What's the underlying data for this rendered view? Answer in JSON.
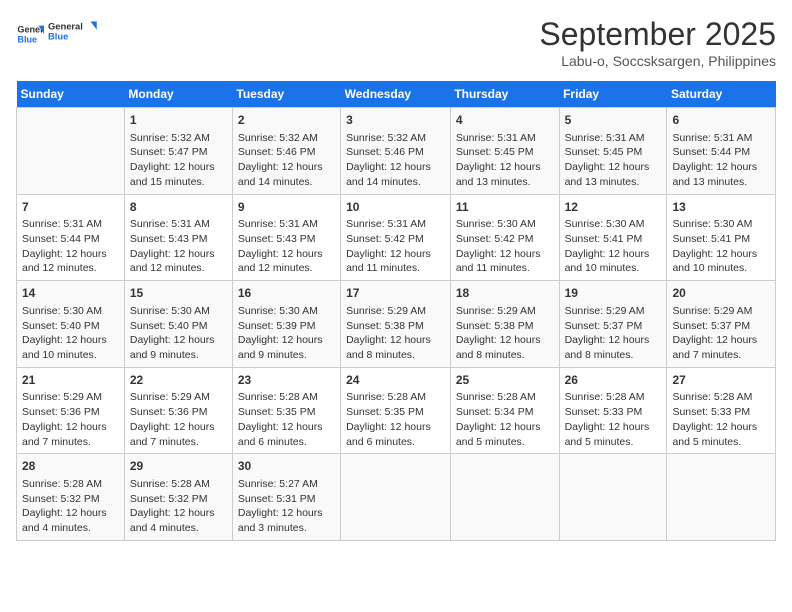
{
  "logo": {
    "line1": "General",
    "line2": "Blue"
  },
  "title": "September 2025",
  "subtitle": "Labu-o, Soccsksargen, Philippines",
  "days_of_week": [
    "Sunday",
    "Monday",
    "Tuesday",
    "Wednesday",
    "Thursday",
    "Friday",
    "Saturday"
  ],
  "weeks": [
    [
      {
        "day": "",
        "content": ""
      },
      {
        "day": "1",
        "content": "Sunrise: 5:32 AM\nSunset: 5:47 PM\nDaylight: 12 hours\nand 15 minutes."
      },
      {
        "day": "2",
        "content": "Sunrise: 5:32 AM\nSunset: 5:46 PM\nDaylight: 12 hours\nand 14 minutes."
      },
      {
        "day": "3",
        "content": "Sunrise: 5:32 AM\nSunset: 5:46 PM\nDaylight: 12 hours\nand 14 minutes."
      },
      {
        "day": "4",
        "content": "Sunrise: 5:31 AM\nSunset: 5:45 PM\nDaylight: 12 hours\nand 13 minutes."
      },
      {
        "day": "5",
        "content": "Sunrise: 5:31 AM\nSunset: 5:45 PM\nDaylight: 12 hours\nand 13 minutes."
      },
      {
        "day": "6",
        "content": "Sunrise: 5:31 AM\nSunset: 5:44 PM\nDaylight: 12 hours\nand 13 minutes."
      }
    ],
    [
      {
        "day": "7",
        "content": "Sunrise: 5:31 AM\nSunset: 5:44 PM\nDaylight: 12 hours\nand 12 minutes."
      },
      {
        "day": "8",
        "content": "Sunrise: 5:31 AM\nSunset: 5:43 PM\nDaylight: 12 hours\nand 12 minutes."
      },
      {
        "day": "9",
        "content": "Sunrise: 5:31 AM\nSunset: 5:43 PM\nDaylight: 12 hours\nand 12 minutes."
      },
      {
        "day": "10",
        "content": "Sunrise: 5:31 AM\nSunset: 5:42 PM\nDaylight: 12 hours\nand 11 minutes."
      },
      {
        "day": "11",
        "content": "Sunrise: 5:30 AM\nSunset: 5:42 PM\nDaylight: 12 hours\nand 11 minutes."
      },
      {
        "day": "12",
        "content": "Sunrise: 5:30 AM\nSunset: 5:41 PM\nDaylight: 12 hours\nand 10 minutes."
      },
      {
        "day": "13",
        "content": "Sunrise: 5:30 AM\nSunset: 5:41 PM\nDaylight: 12 hours\nand 10 minutes."
      }
    ],
    [
      {
        "day": "14",
        "content": "Sunrise: 5:30 AM\nSunset: 5:40 PM\nDaylight: 12 hours\nand 10 minutes."
      },
      {
        "day": "15",
        "content": "Sunrise: 5:30 AM\nSunset: 5:40 PM\nDaylight: 12 hours\nand 9 minutes."
      },
      {
        "day": "16",
        "content": "Sunrise: 5:30 AM\nSunset: 5:39 PM\nDaylight: 12 hours\nand 9 minutes."
      },
      {
        "day": "17",
        "content": "Sunrise: 5:29 AM\nSunset: 5:38 PM\nDaylight: 12 hours\nand 8 minutes."
      },
      {
        "day": "18",
        "content": "Sunrise: 5:29 AM\nSunset: 5:38 PM\nDaylight: 12 hours\nand 8 minutes."
      },
      {
        "day": "19",
        "content": "Sunrise: 5:29 AM\nSunset: 5:37 PM\nDaylight: 12 hours\nand 8 minutes."
      },
      {
        "day": "20",
        "content": "Sunrise: 5:29 AM\nSunset: 5:37 PM\nDaylight: 12 hours\nand 7 minutes."
      }
    ],
    [
      {
        "day": "21",
        "content": "Sunrise: 5:29 AM\nSunset: 5:36 PM\nDaylight: 12 hours\nand 7 minutes."
      },
      {
        "day": "22",
        "content": "Sunrise: 5:29 AM\nSunset: 5:36 PM\nDaylight: 12 hours\nand 7 minutes."
      },
      {
        "day": "23",
        "content": "Sunrise: 5:28 AM\nSunset: 5:35 PM\nDaylight: 12 hours\nand 6 minutes."
      },
      {
        "day": "24",
        "content": "Sunrise: 5:28 AM\nSunset: 5:35 PM\nDaylight: 12 hours\nand 6 minutes."
      },
      {
        "day": "25",
        "content": "Sunrise: 5:28 AM\nSunset: 5:34 PM\nDaylight: 12 hours\nand 5 minutes."
      },
      {
        "day": "26",
        "content": "Sunrise: 5:28 AM\nSunset: 5:33 PM\nDaylight: 12 hours\nand 5 minutes."
      },
      {
        "day": "27",
        "content": "Sunrise: 5:28 AM\nSunset: 5:33 PM\nDaylight: 12 hours\nand 5 minutes."
      }
    ],
    [
      {
        "day": "28",
        "content": "Sunrise: 5:28 AM\nSunset: 5:32 PM\nDaylight: 12 hours\nand 4 minutes."
      },
      {
        "day": "29",
        "content": "Sunrise: 5:28 AM\nSunset: 5:32 PM\nDaylight: 12 hours\nand 4 minutes."
      },
      {
        "day": "30",
        "content": "Sunrise: 5:27 AM\nSunset: 5:31 PM\nDaylight: 12 hours\nand 3 minutes."
      },
      {
        "day": "",
        "content": ""
      },
      {
        "day": "",
        "content": ""
      },
      {
        "day": "",
        "content": ""
      },
      {
        "day": "",
        "content": ""
      }
    ]
  ]
}
